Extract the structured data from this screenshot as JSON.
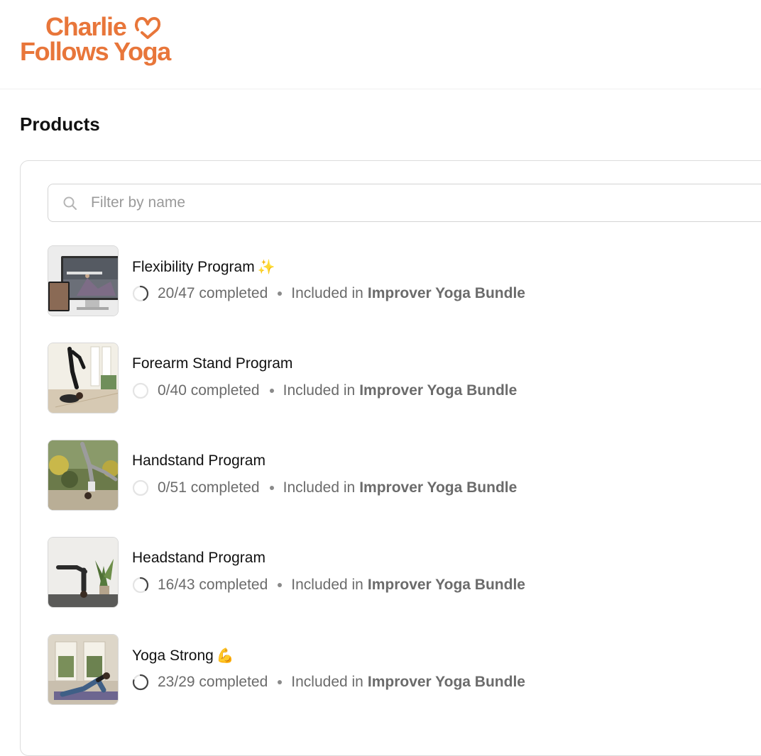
{
  "brand": {
    "logo_line1": "Charlie",
    "logo_line2": "Follows Yoga",
    "accent_color": "#e8763a"
  },
  "page": {
    "title": "Products"
  },
  "search": {
    "placeholder": "Filter by name",
    "value": ""
  },
  "products": [
    {
      "title": "Flexibility Program",
      "emoji": "✨",
      "progress_text": "20/47 completed",
      "completed": 20,
      "total": 47,
      "included_label": "Included in",
      "bundle": "Improver Yoga Bundle",
      "thumbnail_icon": "computer-mockup-image"
    },
    {
      "title": "Forearm Stand Program",
      "emoji": "",
      "progress_text": "0/40 completed",
      "completed": 0,
      "total": 40,
      "included_label": "Included in",
      "bundle": "Improver Yoga Bundle",
      "thumbnail_icon": "forearm-stand-photo"
    },
    {
      "title": "Handstand Program",
      "emoji": "",
      "progress_text": "0/51 completed",
      "completed": 0,
      "total": 51,
      "included_label": "Included in",
      "bundle": "Improver Yoga Bundle",
      "thumbnail_icon": "handstand-photo"
    },
    {
      "title": "Headstand Program",
      "emoji": "",
      "progress_text": "16/43 completed",
      "completed": 16,
      "total": 43,
      "included_label": "Included in",
      "bundle": "Improver Yoga Bundle",
      "thumbnail_icon": "headstand-photo"
    },
    {
      "title": "Yoga Strong",
      "emoji": "💪",
      "progress_text": "23/29 completed",
      "completed": 23,
      "total": 29,
      "included_label": "Included in",
      "bundle": "Improver Yoga Bundle",
      "thumbnail_icon": "yoga-strong-photo"
    }
  ]
}
